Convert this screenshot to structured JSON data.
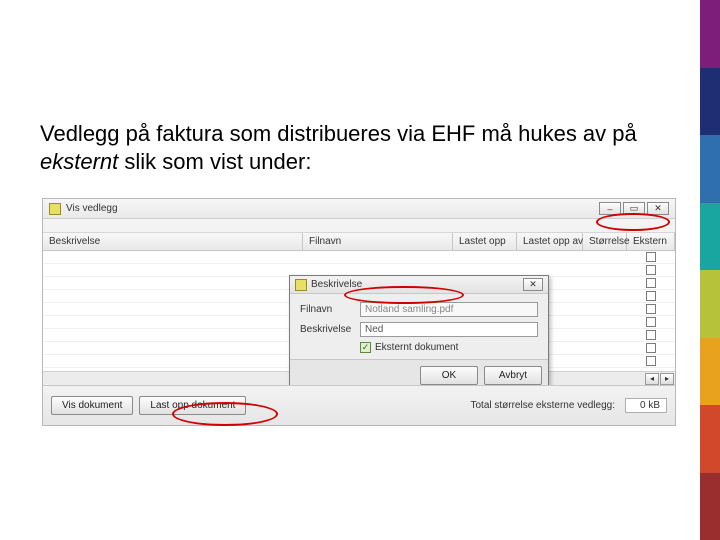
{
  "slide": {
    "heading_prefix": "Vedlegg på faktura som distribueres via EHF må hukes av på ",
    "heading_em": "eksternt",
    "heading_suffix": " slik som vist under:"
  },
  "stripe_colors": [
    "#7d1f7a",
    "#1f2e73",
    "#2f6fb0",
    "#1aa6a0",
    "#b6c23a",
    "#e8a21d",
    "#d1482a",
    "#9a2d2d"
  ],
  "window": {
    "title": "Vis vedlegg",
    "win_min": "–",
    "win_max": "▭",
    "win_close": "✕",
    "columns": {
      "c1": "Beskrivelse",
      "c2": "Filnavn",
      "c3": "Lastet opp",
      "c4": "Lastet opp av",
      "c5": "Størrelse",
      "c6": "Ekstern"
    },
    "row_count": 9,
    "scroll_left": "◂",
    "scroll_right": "▸",
    "footer": {
      "show_doc": "Vis dokument",
      "upload_doc": "Last opp dokument",
      "total_label": "Total størrelse eksterne vedlegg:",
      "total_value": "0 kB"
    }
  },
  "dialog": {
    "title": "Beskrivelse",
    "close": "✕",
    "filnavn_label": "Filnavn",
    "filnavn_value": "Notland samling.pdf",
    "beskrive_label": "Beskrivelse",
    "beskrive_value": "Ned",
    "checkbox_label": "Eksternt dokument",
    "checkbox_checked": "✓",
    "ok": "OK",
    "cancel": "Avbryt"
  }
}
